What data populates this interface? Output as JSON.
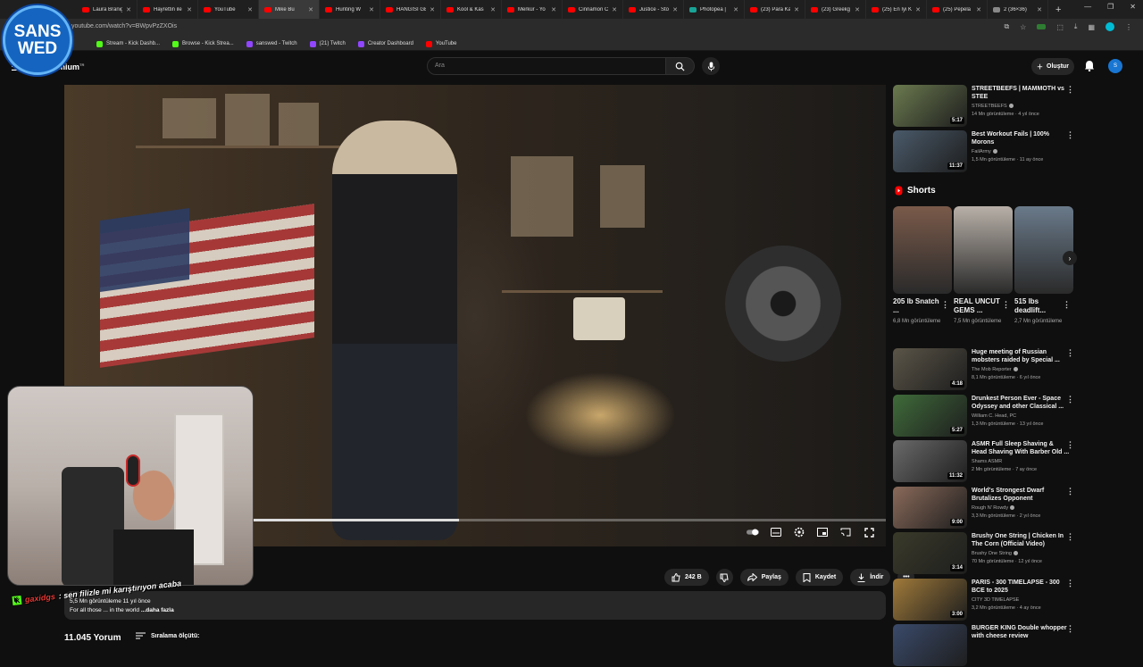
{
  "browser": {
    "tabs": [
      {
        "label": "Laura Branig",
        "color": "#ff0000"
      },
      {
        "label": "Hayrettin ile",
        "color": "#ff0000"
      },
      {
        "label": "YouTube",
        "color": "#ff0000"
      },
      {
        "label": "Mike Bu",
        "color": "#ff0000",
        "active": true
      },
      {
        "label": "Hunting W",
        "color": "#ff0000"
      },
      {
        "label": "HANGİSİ GE",
        "color": "#ff0000"
      },
      {
        "label": "Kool & Kas",
        "color": "#ff0000"
      },
      {
        "label": "Merkür - Yo",
        "color": "#ff0000"
      },
      {
        "label": "Cinnamon C",
        "color": "#ff0000"
      },
      {
        "label": "Justice - Sto",
        "color": "#ff0000"
      },
      {
        "label": "Photopea |",
        "color": "#18a497"
      },
      {
        "label": "(23) Para Ka",
        "color": "#ff0000"
      },
      {
        "label": "(23) Greekg",
        "color": "#ff0000"
      },
      {
        "label": "(25) En İyi K",
        "color": "#ff0000"
      },
      {
        "label": "(25) Pepela",
        "color": "#ff0000"
      },
      {
        "label": "2 (36×36)",
        "color": "#888888"
      }
    ],
    "new_tab": "+",
    "url": "youtube.com/watch?v=BWpvPzZXOis",
    "bookmarks": [
      {
        "label": "Stream - Kick Dashb...",
        "color": "#53fc18"
      },
      {
        "label": "Browse - Kick Strea...",
        "color": "#53fc18"
      },
      {
        "label": "sanswed - Twitch",
        "color": "#9146ff"
      },
      {
        "label": "(21) Twitch",
        "color": "#9146ff"
      },
      {
        "label": "Creator Dashboard",
        "color": "#9146ff"
      },
      {
        "label": "YouTube",
        "color": "#ff0000"
      }
    ]
  },
  "overlay": {
    "logo_line1": "SANS",
    "logo_line2": "WED",
    "chat_icon": "K",
    "chat_user": "gaxidgs",
    "chat_message": ": sen filizle mi karıştırıyon acaba"
  },
  "youtube": {
    "brand": "emium",
    "brand_sup": "TR",
    "search_placeholder": "Ara",
    "create_label": "Oluştur",
    "avatar_letter": "S",
    "player": {
      "progress": 0.48
    },
    "actions": {
      "likes": "242 B",
      "share": "Paylaş",
      "save": "Kaydet",
      "download": "İndir"
    },
    "description": {
      "stats": "5,5 Mn görüntüleme  11 yıl önce",
      "text": "For all those ... in the world ",
      "more": "...daha fazla"
    },
    "comments_count": "11.045 Yorum",
    "sort_label": "Sıralama ölçütü:"
  },
  "sidebar": {
    "videos_top": [
      {
        "title": "STREETBEEFS | MAMMOTH vs STEE",
        "channel": "STREETBEEFS",
        "meta": "14 Mn görüntüleme · 4 yıl önce",
        "duration": "5:17",
        "verified": true
      },
      {
        "title": "Best Workout Fails | 100% Morons",
        "channel": "FailArmy",
        "meta": "1,5 Mn görüntüleme · 11 ay önce",
        "duration": "11:37",
        "verified": true
      }
    ],
    "shorts_title": "Shorts",
    "shorts": [
      {
        "title": "205 lb Snatch ...",
        "views": "6,8 Mn görüntüleme"
      },
      {
        "title": "REAL UNCUT GEMS ...",
        "views": "7,5 Mn görüntüleme"
      },
      {
        "title": "515 lbs deadlift...",
        "views": "2,7 Mn görüntüleme"
      }
    ],
    "videos": [
      {
        "title": "Huge meeting of Russian mobsters raided by Special ...",
        "channel": "The Mob Reporter",
        "meta": "8,1 Mn görüntüleme · 6 yıl önce",
        "duration": "4:18",
        "verified": true
      },
      {
        "title": "Drunkest Person Ever - Space Odyssey and other Classical ...",
        "channel": "William C. Head, PC",
        "meta": "1,3 Mn görüntüleme · 13 yıl önce",
        "duration": "5:27",
        "verified": false
      },
      {
        "title": "ASMR Full Sleep Shaving & Head Shaving With Barber Old ...",
        "channel": "Shams ASMR",
        "meta": "2 Mn görüntüleme · 7 ay önce",
        "duration": "11:32",
        "verified": false
      },
      {
        "title": "World's Strongest Dwarf Brutalizes Opponent",
        "channel": "Rough N' Rowdy",
        "meta": "3,3 Mn görüntüleme · 2 yıl önce",
        "duration": "9:00",
        "verified": true
      },
      {
        "title": "Brushy One String | Chicken In The Corn (Official Video)",
        "channel": "Brushy One String",
        "meta": "70 Mn görüntüleme · 12 yıl önce",
        "duration": "3:14",
        "verified": true
      },
      {
        "title": "PARIS - 300 TIMELAPSE - 300 BCE to 2025",
        "channel": "CITY 3D TIMELAPSE",
        "meta": "3,2 Mn görüntüleme · 4 ay önce",
        "duration": "3:00",
        "verified": false
      },
      {
        "title": "BURGER KING Double whopper with cheese review",
        "channel": "",
        "meta": "",
        "duration": "",
        "verified": false
      }
    ]
  }
}
